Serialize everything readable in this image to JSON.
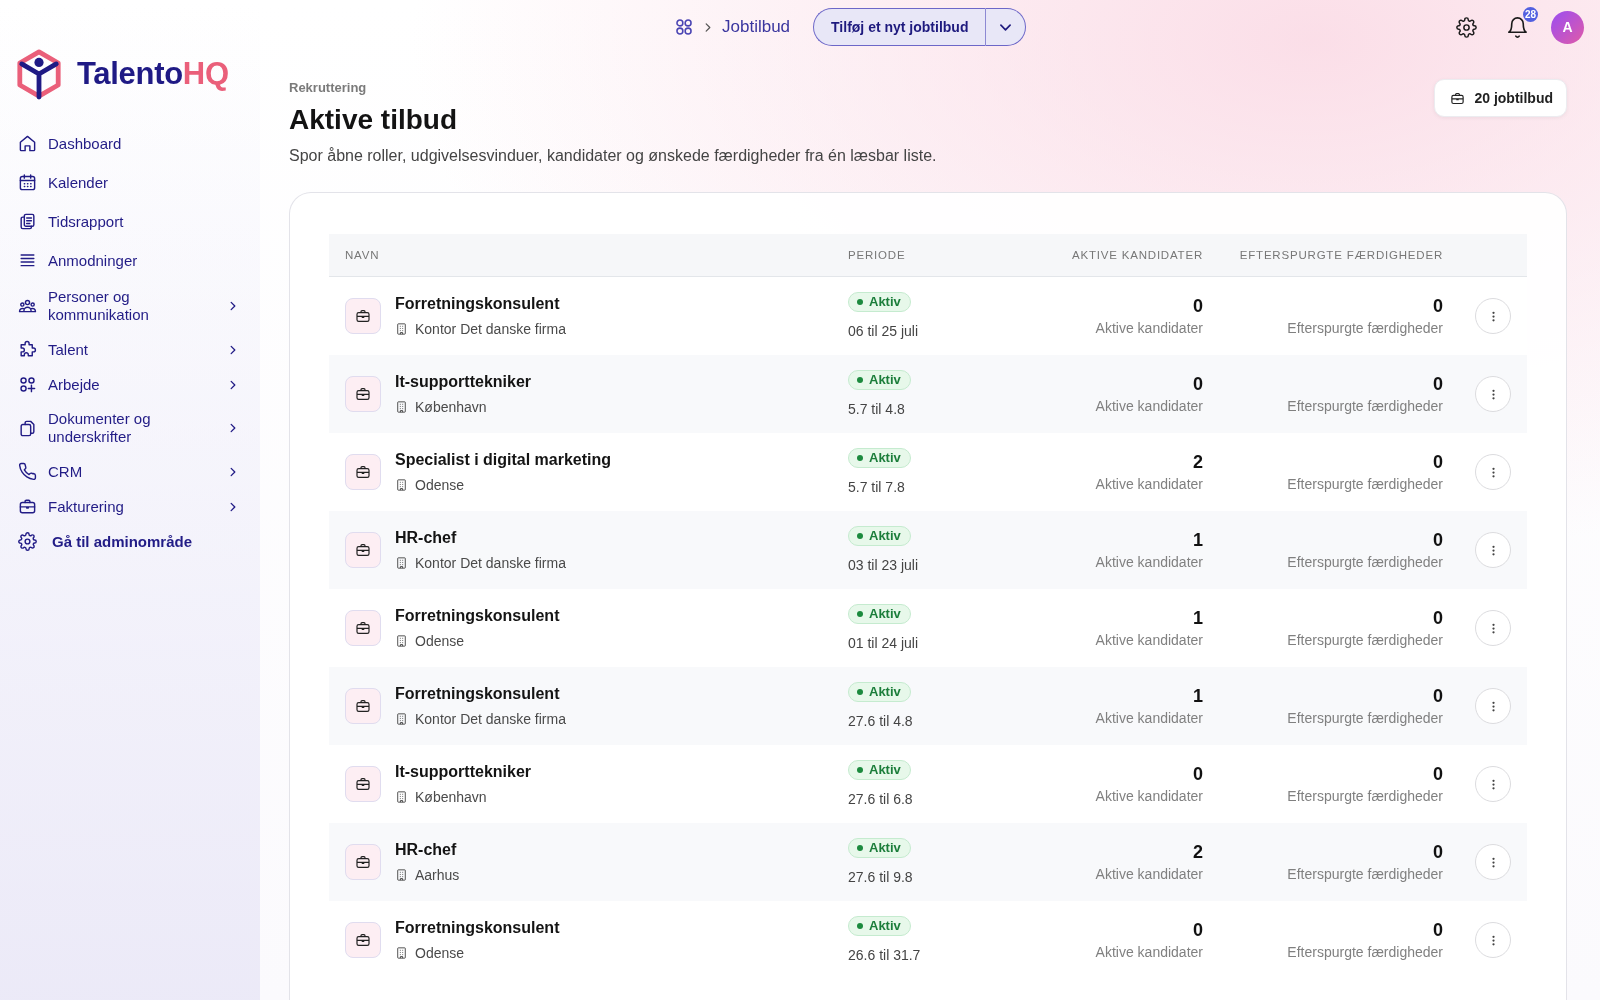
{
  "logo": {
    "name": "Talento",
    "accent": "HQ"
  },
  "sidebar": {
    "items": [
      {
        "label": "Dashboard",
        "kind": "link"
      },
      {
        "label": "Kalender",
        "kind": "link"
      },
      {
        "label": "Tidsrapport",
        "kind": "link"
      },
      {
        "label": "Anmodninger",
        "kind": "link"
      },
      {
        "label": "Personer og kommunikation",
        "kind": "group"
      },
      {
        "label": "Talent",
        "kind": "group"
      },
      {
        "label": "Arbejde",
        "kind": "group"
      },
      {
        "label": "Dokumenter og underskrifter",
        "kind": "group"
      },
      {
        "label": "CRM",
        "kind": "group"
      },
      {
        "label": "Fakturering",
        "kind": "group"
      },
      {
        "label": "Gå til adminområde",
        "kind": "action"
      }
    ]
  },
  "topbar": {
    "breadcrumb": "Jobtilbud",
    "add_button": "Tilføj et nyt jobtilbud",
    "notification_count": "28",
    "avatar_initial": "A"
  },
  "header": {
    "section": "Rekruttering",
    "title": "Aktive tilbud",
    "subtitle": "Spor åbne roller, udgivelsesvinduer, kandidater og ønskede færdigheder fra én læsbar liste.",
    "count_button": "20 jobtilbud"
  },
  "table": {
    "columns": [
      "NAVN",
      "PERIODE",
      "AKTIVE KANDIDATER",
      "EFTERSPURGTE FÆRDIGHEDER"
    ],
    "rows": [
      {
        "title": "Forretningskonsulent",
        "location": "Kontor Det danske firma",
        "status": "Aktiv",
        "period": "06 til 25 juli",
        "candidates": "0",
        "candidates_label": "Aktive kandidater",
        "skills": "0",
        "skills_label": "Efterspurgte færdigheder"
      },
      {
        "title": "It-supporttekniker",
        "location": "København",
        "status": "Aktiv",
        "period": "5.7 til 4.8",
        "candidates": "0",
        "candidates_label": "Aktive kandidater",
        "skills": "0",
        "skills_label": "Efterspurgte færdigheder"
      },
      {
        "title": "Specialist i digital marketing",
        "location": "Odense",
        "status": "Aktiv",
        "period": "5.7 til 7.8",
        "candidates": "2",
        "candidates_label": "Aktive kandidater",
        "skills": "0",
        "skills_label": "Efterspurgte færdigheder"
      },
      {
        "title": "HR-chef",
        "location": "Kontor Det danske firma",
        "status": "Aktiv",
        "period": "03 til 23 juli",
        "candidates": "1",
        "candidates_label": "Aktive kandidater",
        "skills": "0",
        "skills_label": "Efterspurgte færdigheder"
      },
      {
        "title": "Forretningskonsulent",
        "location": "Odense",
        "status": "Aktiv",
        "period": "01 til 24 juli",
        "candidates": "1",
        "candidates_label": "Aktive kandidater",
        "skills": "0",
        "skills_label": "Efterspurgte færdigheder"
      },
      {
        "title": "Forretningskonsulent",
        "location": "Kontor Det danske firma",
        "status": "Aktiv",
        "period": "27.6 til 4.8",
        "candidates": "1",
        "candidates_label": "Aktive kandidater",
        "skills": "0",
        "skills_label": "Efterspurgte færdigheder"
      },
      {
        "title": "It-supporttekniker",
        "location": "København",
        "status": "Aktiv",
        "period": "27.6 til 6.8",
        "candidates": "0",
        "candidates_label": "Aktive kandidater",
        "skills": "0",
        "skills_label": "Efterspurgte færdigheder"
      },
      {
        "title": "HR-chef",
        "location": "Aarhus",
        "status": "Aktiv",
        "period": "27.6 til 9.8",
        "candidates": "2",
        "candidates_label": "Aktive kandidater",
        "skills": "0",
        "skills_label": "Efterspurgte færdigheder"
      },
      {
        "title": "Forretningskonsulent",
        "location": "Odense",
        "status": "Aktiv",
        "period": "26.6 til 31.7",
        "candidates": "0",
        "candidates_label": "Aktive kandidater",
        "skills": "0",
        "skills_label": "Efterspurgte færdigheder"
      }
    ]
  }
}
